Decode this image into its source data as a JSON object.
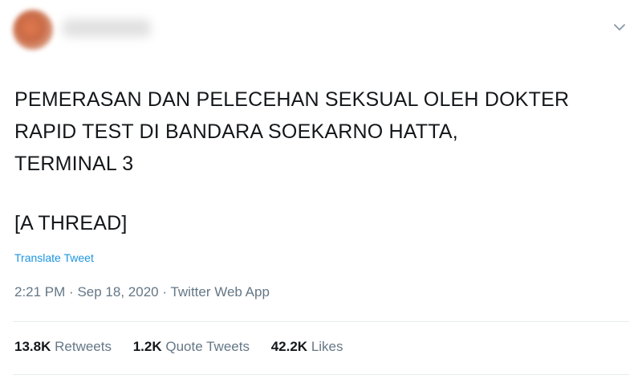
{
  "tweet": {
    "text_lines": [
      "PEMERASAN DAN PELECEHAN SEKSUAL OLEH DOKTER",
      "RAPID TEST DI BANDARA SOEKARNO HATTA,",
      "TERMINAL 3",
      "[A THREAD]"
    ],
    "translate_label": "Translate Tweet",
    "time": "2:21 PM",
    "separator": "·",
    "date": "Sep 18, 2020",
    "source": "Twitter Web App"
  },
  "stats": {
    "retweets_count": "13.8K",
    "retweets_label": "Retweets",
    "quote_count": "1.2K",
    "quote_label": "Quote Tweets",
    "likes_count": "42.2K",
    "likes_label": "Likes"
  },
  "icons": {
    "caret": "chevron-down-icon"
  },
  "colors": {
    "link": "#1b95e0",
    "secondary_text": "#657786",
    "primary_text": "#14171a",
    "divider": "#e6ecf0"
  }
}
